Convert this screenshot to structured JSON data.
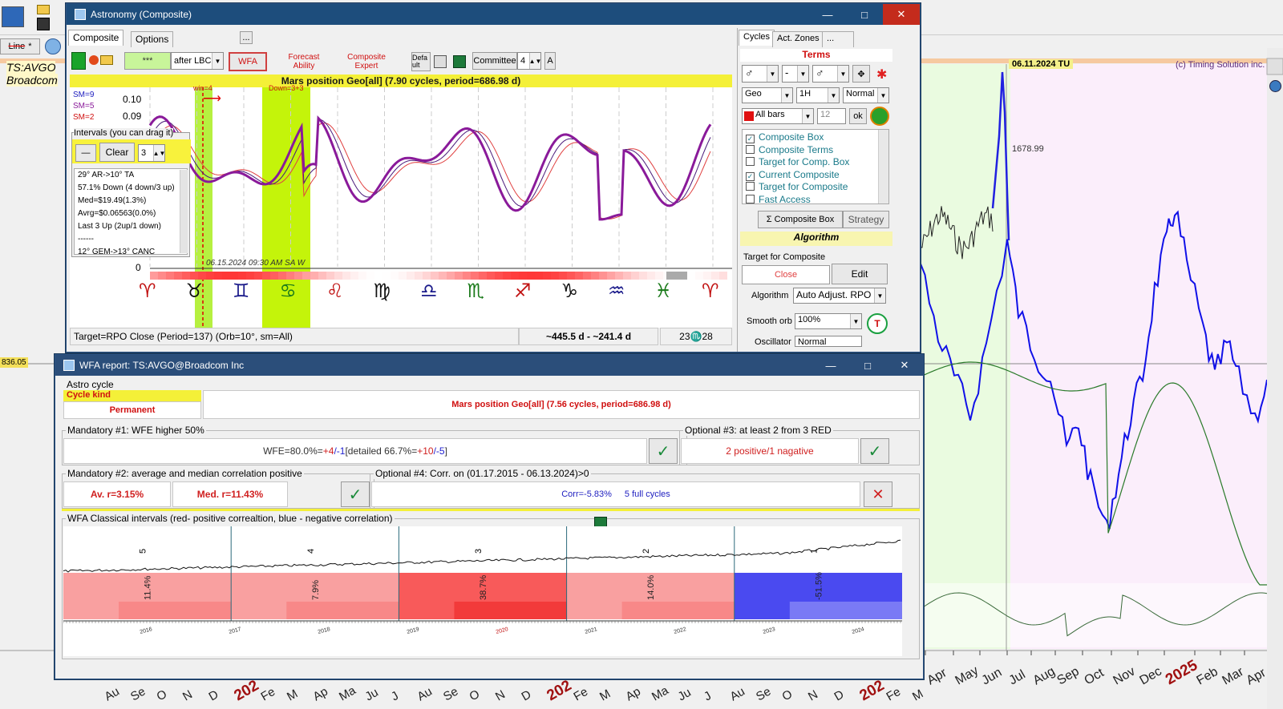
{
  "main": {
    "symbol": "TS:AVGO",
    "company": "Broadcom",
    "date_marker": "06.11.2024 TU",
    "copyright": "(c) Timing Solution inc.",
    "price_level": "836.05",
    "peak_price": "1678.99",
    "toolbar_line": "Line",
    "months": [
      "Apr",
      "May",
      "Jun",
      "Jul",
      "Aug",
      "Sep",
      "Oct",
      "Nov",
      "Dec",
      "2025",
      "Feb",
      "Mar",
      "Apr"
    ],
    "left_dates": [
      "Au",
      "Se",
      "O",
      "N",
      "D",
      "202",
      "Fe",
      "M",
      "Ap",
      "Ma",
      "Ju",
      "J",
      "Au",
      "Se",
      "O",
      "N",
      "D",
      "202",
      "Fe",
      "M",
      "Ap",
      "Ma",
      "Ju",
      "J",
      "Au",
      "Se",
      "O",
      "N",
      "D",
      "202",
      "Fe",
      "M"
    ]
  },
  "astro": {
    "title": "Astronomy (Composite)",
    "tabs": [
      "Composite",
      "Options"
    ],
    "toolbar": {
      "stars": "***",
      "after": "after LBC",
      "wfa": "WFA",
      "forecast": [
        "Forecast",
        "Ability"
      ],
      "composite_expert": [
        "Composite",
        "Expert"
      ],
      "defa": "Defa ult",
      "committee": "Committee",
      "committee_val": "4",
      "a_btn": "A",
      "dots": "..."
    },
    "banner": "Mars position Geo[all]  (7.90 cycles, period=686.98 d)",
    "sm_labels": [
      "SM=9",
      "SM=5",
      "SM=2"
    ],
    "y_labels": [
      "0.10",
      "0.09",
      "0"
    ],
    "win_label": "win=4",
    "down_label": "Down=3+3",
    "date_label": "06.15.2024  09:30 AM SA  W",
    "intervals": {
      "title": "Intervals (you can drag it)",
      "clear": "Clear",
      "num": "3",
      "lines": [
        "29° AR->10° TA",
        "57.1% Down (4 down/3 up)",
        "Med=$19.49(1.3%)",
        "Avrg=$0.06563(0.0%)",
        "Last 3 Up (2up/1 down)",
        "------",
        "12° GEM->13° CANC",
        "..."
      ]
    },
    "zodiac": [
      "♈",
      "♉",
      "♊",
      "♋",
      "♌",
      "♍",
      "♎",
      "♏",
      "♐",
      "♑",
      "♒",
      "♓",
      "♈"
    ],
    "status": {
      "target": "Target=RPO Close (Period=137) (Orb=10°, sm=All)",
      "range": "~445.5 d - ~241.4 d",
      "degree": "23♏28"
    },
    "right": {
      "tabs": [
        "Cycles",
        "Act. Zones",
        "..."
      ],
      "terms": "Terms",
      "planet1": "♂",
      "dash": "-",
      "planet2": "♂",
      "geo": "Geo",
      "tf": "1H",
      "normal": "Normal",
      "allbars": "All bars",
      "n12": "12",
      "ok": "ok",
      "list": [
        {
          "label": "Composite Box",
          "checked": true
        },
        {
          "label": "Composite Terms",
          "checked": false
        },
        {
          "label": "Target for Comp. Box",
          "checked": false
        },
        {
          "label": "Current Composite",
          "checked": true
        },
        {
          "label": "Target for Composite",
          "checked": false
        },
        {
          "label": "Fast Access",
          "checked": false
        }
      ],
      "composite_box": "Σ Composite Box",
      "strategy": "Strategy",
      "algorithm_hdr": "Algorithm",
      "target_lbl": "Target for Composite",
      "close": "Close",
      "edit": "Edit",
      "algorithm_lbl": "Algorithm",
      "algorithm_val": "Auto Adjust. RPO",
      "smooth_lbl": "Smooth orb",
      "smooth_val": "100%",
      "osc_lbl": "Oscillator",
      "osc_val": "Normal"
    }
  },
  "wfa": {
    "title": "WFA report: TS:AVGO@Broadcom Inc",
    "astro_cycle": "Astro cycle",
    "cycle_kind": "Cycle kind",
    "permanent": "Permanent",
    "cycle_name": "Mars position Geo[all]  (7.56 cycles, period=686.98 d)",
    "m1_title": "Mandatory #1: WFE higher 50%",
    "m1_main": "WFE=80.0%=",
    "m1_pos": "+4",
    "m1_neg": "/-1",
    "m1_det": " [detailed 66.7%=",
    "m1_dpos": "+10",
    "m1_dneg": "/-5",
    "m1_end": "]",
    "o3_title": "Optional #3: at least 2 from 3 RED",
    "o3_val": "2 positive/1 nagative",
    "m2_title": "Mandatory #2: average and median correlation  positive",
    "m2_av": "Av. r=3.15%",
    "m2_med": "Med. r=11.43%",
    "o4_title": "Optional #4: Corr. on (01.17.2015 - 06.13.2024)>0",
    "o4_corr": "Corr=-5.83%",
    "o4_cycles": "5 full cycles",
    "classical_title": "WFA Classical intervals (red- positive correaltion, blue - negative correlation)",
    "intervals": [
      {
        "n": "5",
        "pct": "11.4%",
        "value": 11.4
      },
      {
        "n": "4",
        "pct": "7.9%",
        "value": 7.9
      },
      {
        "n": "3",
        "pct": "38.7%",
        "value": 38.7
      },
      {
        "n": "2",
        "pct": "14.0%",
        "value": 14.0
      },
      {
        "n": "1",
        "pct": "-51.5%",
        "value": -51.5
      }
    ],
    "years": [
      "2016",
      "2017",
      "2018",
      "2019",
      "2020",
      "2021",
      "2022",
      "2023",
      "2024"
    ],
    "colors": {
      "pos_light": "#f9a0a0",
      "pos_strong": "#f85a5a",
      "neg": "#4a4af0"
    }
  }
}
